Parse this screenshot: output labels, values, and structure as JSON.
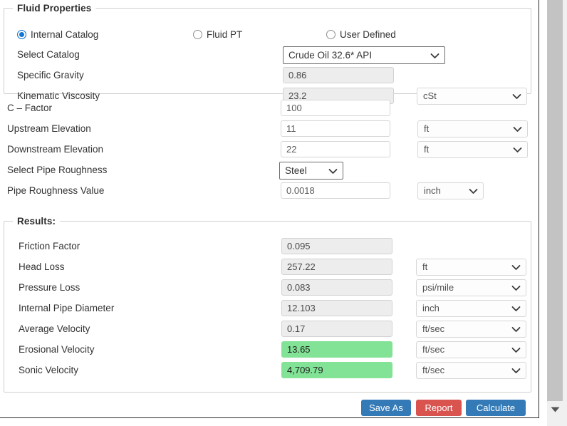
{
  "fluid_properties": {
    "legend": "Fluid Properties",
    "radios": [
      {
        "label": "Internal Catalog",
        "checked": true
      },
      {
        "label": "Fluid PT",
        "checked": false
      },
      {
        "label": "User Defined",
        "checked": false
      }
    ],
    "rows": [
      {
        "label": "Select Catalog",
        "value": "Crude Oil 32.6* API",
        "unit": ""
      },
      {
        "label": "Specific Gravity",
        "value": "0.86",
        "unit": ""
      },
      {
        "label": "Kinematic Viscosity",
        "value": "23.2",
        "unit": "cSt"
      }
    ]
  },
  "pipe_inputs": {
    "rows": [
      {
        "label": "C – Factor",
        "value": "100",
        "unit": ""
      },
      {
        "label": "Upstream Elevation",
        "value": "11",
        "unit": "ft"
      },
      {
        "label": "Downstream Elevation",
        "value": "22",
        "unit": "ft"
      },
      {
        "label": "Select Pipe Roughness",
        "value": "Steel",
        "unit": ""
      },
      {
        "label": "Pipe Roughness Value",
        "value": "0.0018",
        "unit": "inch"
      }
    ]
  },
  "results": {
    "legend": "Results:",
    "rows": [
      {
        "label": "Friction Factor",
        "value": "0.095",
        "unit": "",
        "highlight": false
      },
      {
        "label": "Head Loss",
        "value": "257.22",
        "unit": "ft",
        "highlight": false
      },
      {
        "label": "Pressure Loss",
        "value": "0.083",
        "unit": "psi/mile",
        "highlight": false
      },
      {
        "label": "Internal Pipe Diameter",
        "value": "12.103",
        "unit": "inch",
        "highlight": false
      },
      {
        "label": "Average Velocity",
        "value": "0.17",
        "unit": "ft/sec",
        "highlight": false
      },
      {
        "label": "Erosional Velocity",
        "value": "13.65",
        "unit": "ft/sec",
        "highlight": true
      },
      {
        "label": "Sonic Velocity",
        "value": "4,709.79",
        "unit": "ft/sec",
        "highlight": true
      }
    ]
  },
  "buttons": [
    {
      "label": "Save As",
      "style": "blue"
    },
    {
      "label": "Report",
      "style": "red"
    },
    {
      "label": "Calculate",
      "style": "blue"
    }
  ],
  "icons": {
    "chevron_down": "chevron-down-icon",
    "scroll_down_arrow": "scroll-down-arrow-icon"
  },
  "colors": {
    "accent_blue": "#337ab7",
    "danger_red": "#d9534f",
    "highlight_green": "#82e296",
    "radio_selected": "#1176d4",
    "field_disabled_bg": "#ededed"
  }
}
